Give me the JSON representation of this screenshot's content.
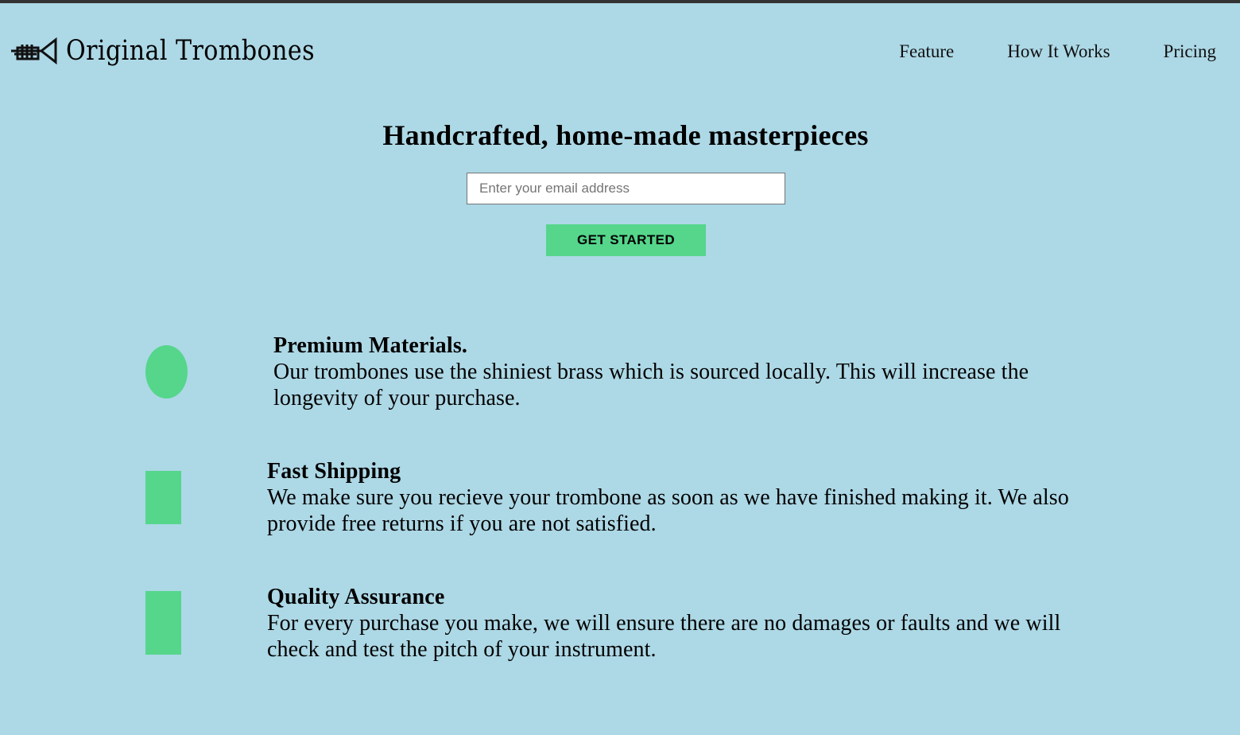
{
  "header": {
    "brand": "Original Trombones",
    "nav": [
      {
        "label": "Feature"
      },
      {
        "label": "How It Works"
      },
      {
        "label": "Pricing"
      }
    ]
  },
  "hero": {
    "title": "Handcrafted, home-made masterpieces",
    "email_placeholder": "Enter your email address",
    "email_value": "",
    "cta_label": "GET STARTED"
  },
  "features": [
    {
      "title": "Premium Materials.",
      "description": "Our trombones use the shiniest brass which is sourced locally. This will increase the longevity of your purchase.",
      "icon": "circle-shape"
    },
    {
      "title": "Fast Shipping",
      "description": "We make sure you recieve your trombone as soon as we have finished making it. We also provide free returns if you are not satisfied.",
      "icon": "rectangle-shape"
    },
    {
      "title": "Quality Assurance",
      "description": "For every purchase you make, we will ensure there are no damages or faults and we will check and test the pitch of your instrument.",
      "icon": "rectangle-shape"
    }
  ],
  "colors": {
    "background": "#add8e6",
    "accent": "#55d68b",
    "top_border": "#333333"
  }
}
